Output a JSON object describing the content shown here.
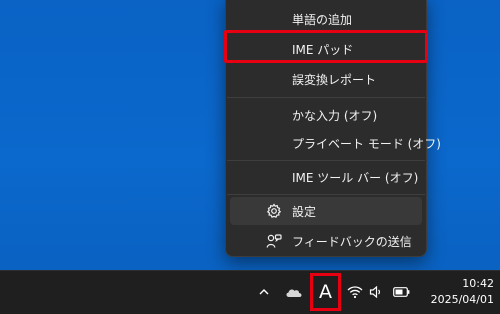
{
  "menu": {
    "items": [
      {
        "label": "単語の追加"
      },
      {
        "label": "IME パッド"
      },
      {
        "label": "誤変換レポート"
      },
      {
        "label": "かな入力 (オフ)"
      },
      {
        "label": "プライベート モード (オフ)"
      },
      {
        "label": "IME ツール バー (オフ)"
      },
      {
        "label": "設定",
        "icon": "gear-icon"
      },
      {
        "label": "フィードバックの送信",
        "icon": "feedback-icon"
      }
    ]
  },
  "taskbar": {
    "ime_indicator": "A",
    "icons": [
      "chevron-up-icon",
      "onedrive-cloud-icon",
      "wifi-icon",
      "speaker-icon",
      "battery-icon"
    ],
    "time": "10:42",
    "date": "2025/04/01"
  },
  "colors": {
    "desktop": "#0b63c4",
    "menu_bg": "#2c2c2c",
    "taskbar_bg": "#1f1f1f",
    "highlight": "#e60012"
  }
}
